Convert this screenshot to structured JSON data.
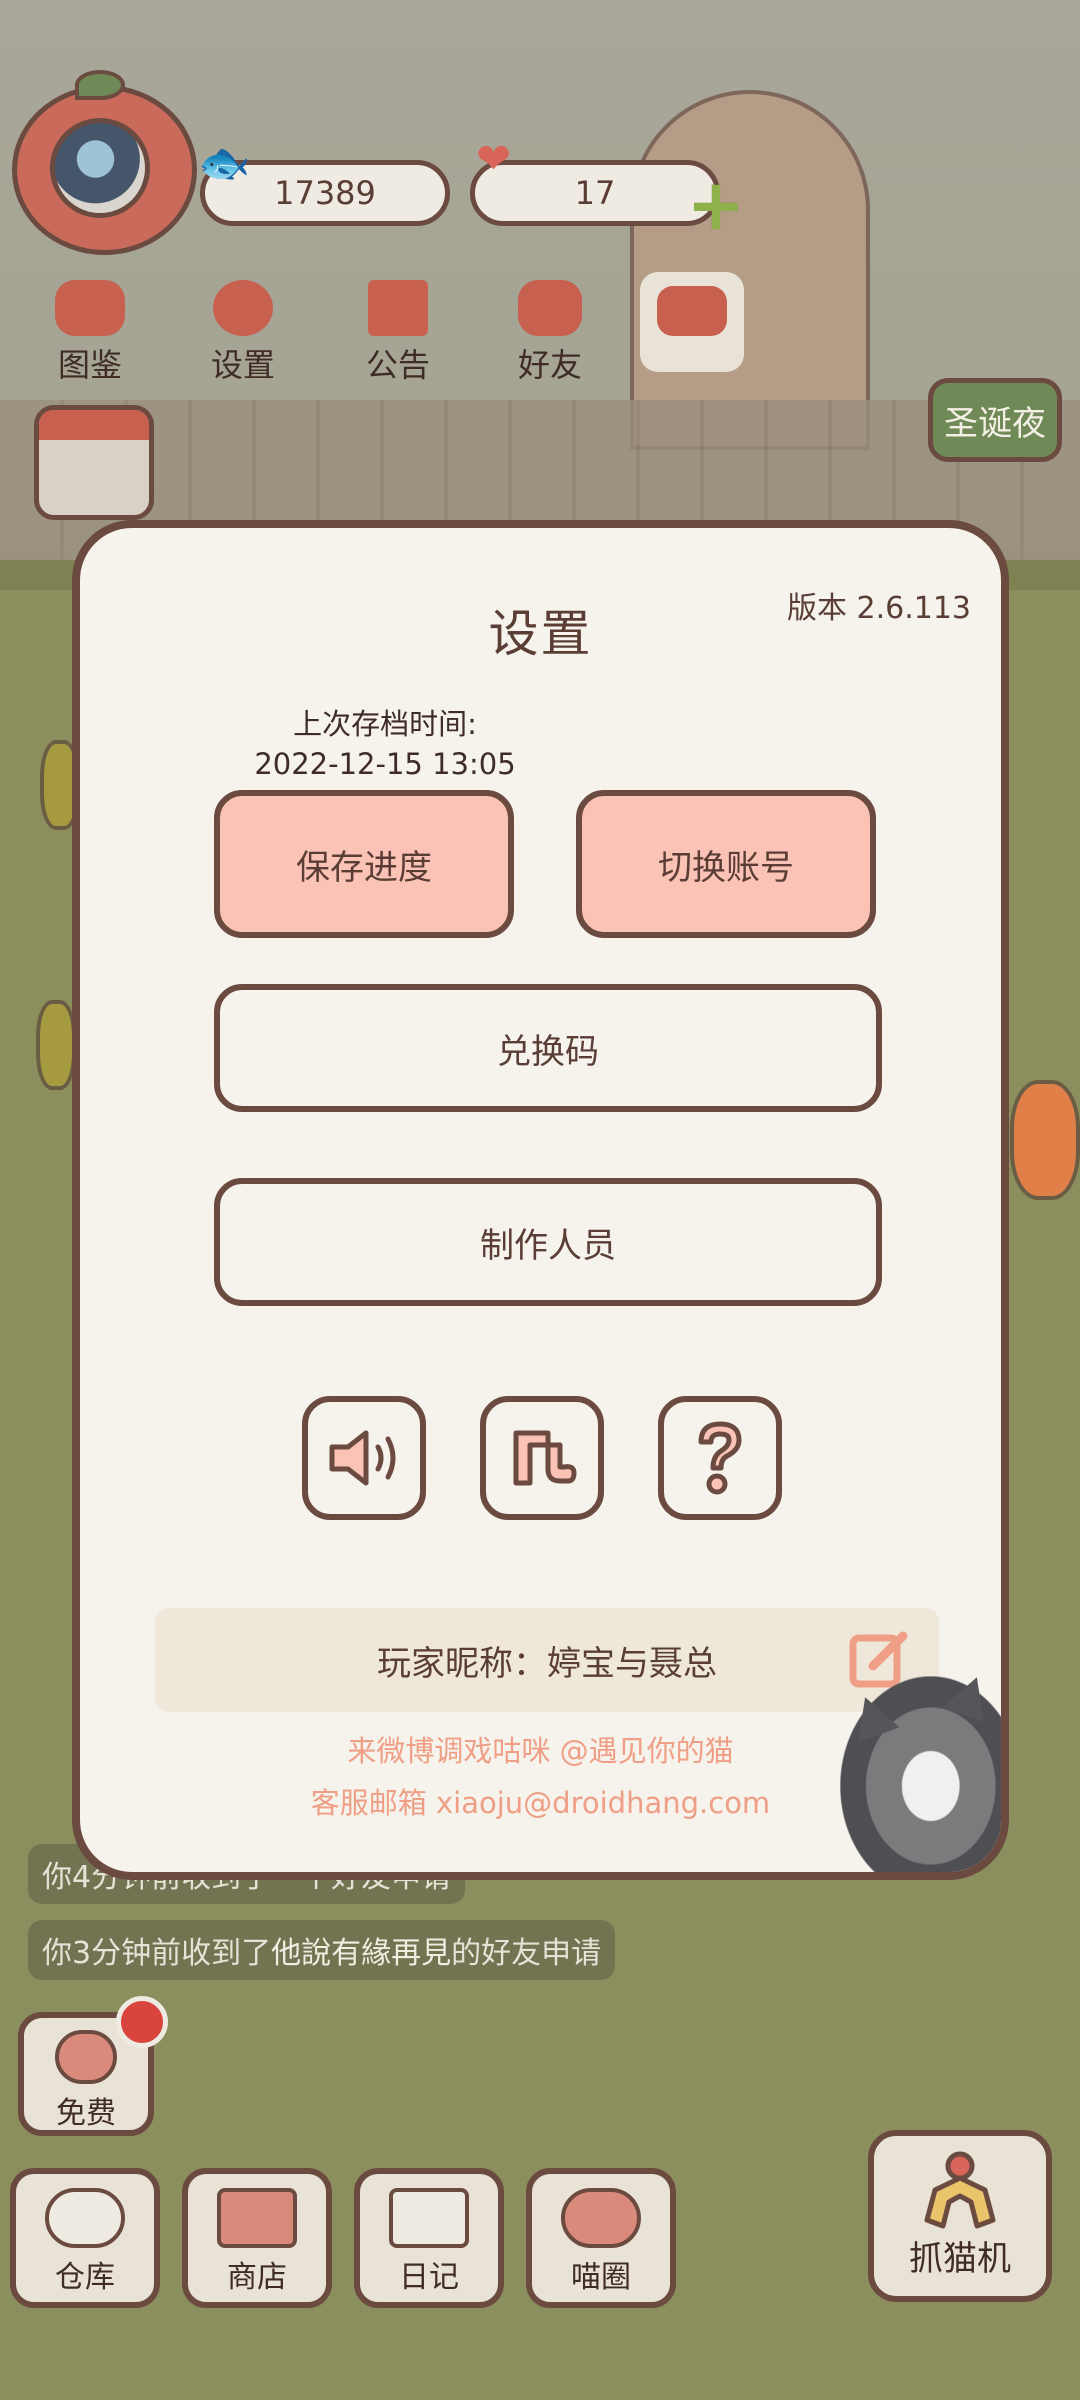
{
  "hud": {
    "fish_count": "17389",
    "heart_count": "17",
    "menu": [
      {
        "label": "图鉴",
        "icon": "cat-book-icon"
      },
      {
        "label": "设置",
        "icon": "gear-icon"
      },
      {
        "label": "公告",
        "icon": "gift-icon"
      },
      {
        "label": "好友",
        "icon": "friends-icon"
      }
    ],
    "event_label": "圣诞夜"
  },
  "dialog": {
    "title": "设置",
    "version": "版本 2.6.113",
    "save_time_label": "上次存档时间:",
    "save_time_value": "2022-12-15 13:05",
    "save_button": "保存进度",
    "switch_account_button": "切换账号",
    "redeem_code_button": "兑换码",
    "credits_button": "制作人员",
    "icons": [
      "speaker-icon",
      "music-note-icon",
      "question-mark-icon"
    ],
    "nickname": "玩家昵称：婷宝与聂总",
    "footer_weibo": "来微博调戏咕咪 @遇见你的猫",
    "footer_email": "客服邮箱 xiaoju@droidhang.com"
  },
  "notifications": [
    {
      "text": "你4分钟前收到了一个好友申请"
    },
    {
      "prefix": "你3分钟前收到了",
      "name": "他說有緣再見",
      "suffix": "的好友申请"
    }
  ],
  "bottom_bar": {
    "free": "免费",
    "warehouse": "仓库",
    "shop": "商店",
    "diary": "日记",
    "cat_circle": "喵圈",
    "claw_machine": "抓猫机"
  },
  "colors": {
    "dialog_bg": "#f6f2ec",
    "border": "#6b4a40",
    "pink_button": "#fbc3b6",
    "footer_text": "#ef9f85",
    "event_green": "#6f8a56"
  }
}
